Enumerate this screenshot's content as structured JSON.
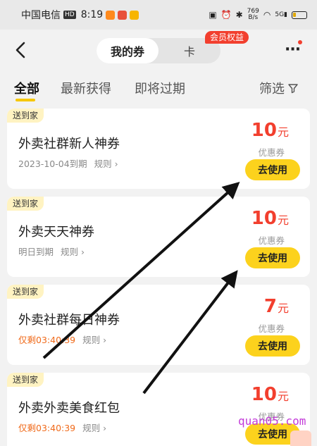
{
  "status_bar": {
    "carrier": "中国电信",
    "hd_badge": "HD",
    "time": "8:19",
    "net_speed_value": "769",
    "net_speed_unit": "B/s",
    "signal_label": "5G"
  },
  "header": {
    "tab_coupons": "我的券",
    "tab_cards": "卡",
    "member_badge": "会员权益"
  },
  "filter_tabs": [
    {
      "label": "全部",
      "active": true
    },
    {
      "label": "最新获得",
      "active": false
    },
    {
      "label": "即将过期",
      "active": false
    }
  ],
  "filter_button": "筛选",
  "coupons": [
    {
      "tag": "送到家",
      "title": "外卖社群新人神券",
      "expire": "2023-10-04到期",
      "rule": "规则",
      "amount": "10",
      "unit": "元",
      "kind": "优惠券",
      "button": "去使用"
    },
    {
      "tag": "送到家",
      "title": "外卖天天神券",
      "expire": "明日到期",
      "rule": "规则",
      "amount": "10",
      "unit": "元",
      "kind": "优惠券",
      "button": "去使用"
    },
    {
      "tag": "送到家",
      "title": "外卖社群每日神券",
      "expire": "仅剩03:40:39",
      "rule": "规则",
      "amount": "7",
      "unit": "元",
      "kind": "优惠券",
      "button": "去使用"
    },
    {
      "tag": "送到家",
      "title": "外卖外卖美食红包",
      "expire": "仅剩03:40:39",
      "rule": "规则",
      "amount": "10",
      "unit": "元",
      "kind": "优惠券",
      "button": "去使用"
    }
  ],
  "watermark": "quan05.com",
  "colors": {
    "accent_yellow": "#fcd21d",
    "price_red": "#f23f2e",
    "countdown_orange": "#f06a1a"
  }
}
